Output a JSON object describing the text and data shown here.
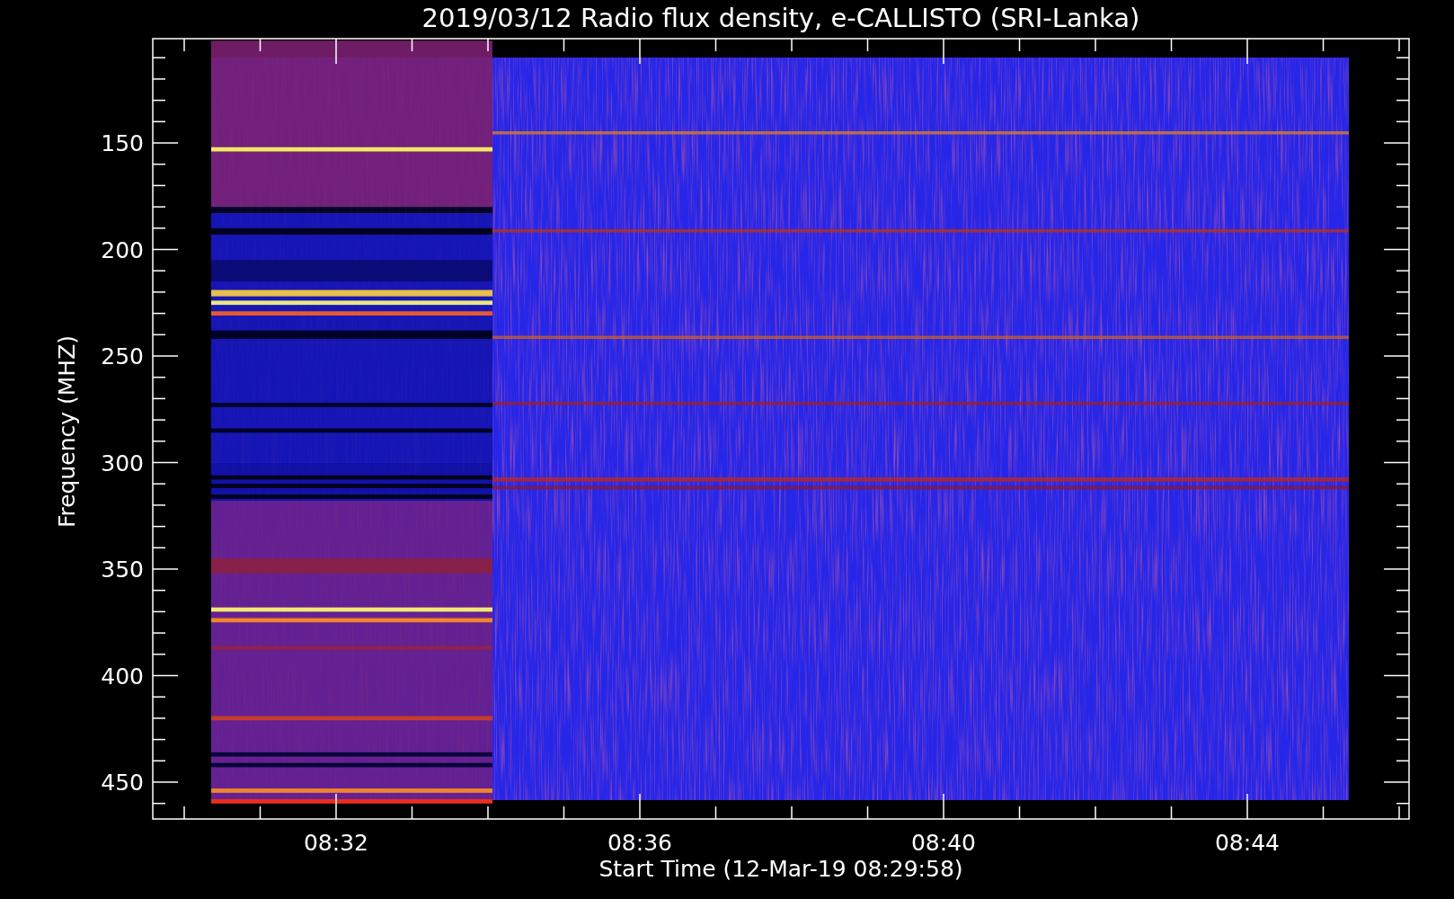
{
  "plot": {
    "title": "2019/03/12  Radio flux density, e-CALLISTO (SRI-Lanka)",
    "y_axis": {
      "label": "Frequency (MHZ)",
      "tick_labels": [
        "150",
        "200",
        "250",
        "300",
        "350",
        "400",
        "450"
      ]
    },
    "x_axis": {
      "label": "Start Time (12-Mar-19 08:29:58)",
      "tick_labels": [
        "08:32",
        "08:36",
        "08:40",
        "08:44"
      ]
    }
  }
}
